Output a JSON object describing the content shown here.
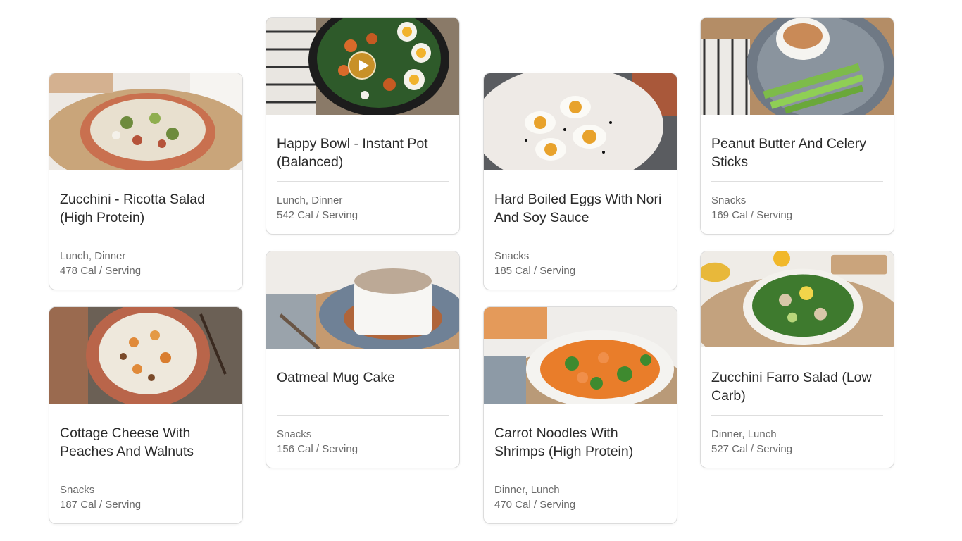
{
  "recipes": [
    {
      "title": "Zucchini - Ricotta Salad (High Protein)",
      "meals": "Lunch, Dinner",
      "calories": "478 Cal / Serving"
    },
    {
      "title": "Cottage Cheese With Peaches And Walnuts",
      "meals": "Snacks",
      "calories": "187 Cal / Serving"
    },
    {
      "title": "Happy Bowl - Instant Pot (Balanced)",
      "meals": "Lunch, Dinner",
      "calories": "542 Cal / Serving"
    },
    {
      "title": "Oatmeal Mug Cake",
      "meals": "Snacks",
      "calories": "156 Cal / Serving"
    },
    {
      "title": "Hard Boiled Eggs With Nori And Soy Sauce",
      "meals": "Snacks",
      "calories": "185 Cal / Serving"
    },
    {
      "title": "Carrot Noodles With Shrimps (High Protein)",
      "meals": "Dinner, Lunch",
      "calories": "470 Cal / Serving"
    },
    {
      "title": "Peanut Butter And Celery Sticks",
      "meals": "Snacks",
      "calories": "169 Cal / Serving"
    },
    {
      "title": "Zucchini Farro Salad (Low Carb)",
      "meals": "Dinner, Lunch",
      "calories": "527 Cal / Serving"
    }
  ],
  "icons": {
    "play": "play-icon"
  }
}
